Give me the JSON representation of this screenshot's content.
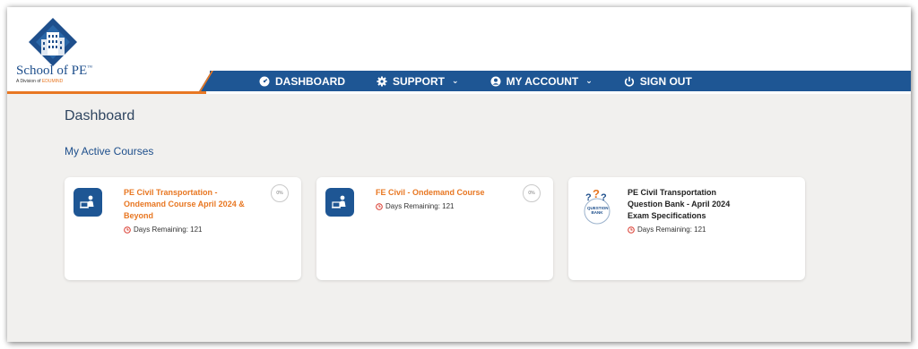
{
  "brand": {
    "name": "School of PE",
    "trademark": "™",
    "division_prefix": "A Division of",
    "division_brand": "EDUMIND"
  },
  "nav": [
    {
      "label": "DASHBOARD",
      "icon": "tachometer-icon",
      "dropdown": false
    },
    {
      "label": "SUPPORT",
      "icon": "gear-icon",
      "dropdown": true
    },
    {
      "label": "MY ACCOUNT",
      "icon": "user-circle-icon",
      "dropdown": true
    },
    {
      "label": "SIGN OUT",
      "icon": "power-icon",
      "dropdown": false
    }
  ],
  "page": {
    "title": "Dashboard",
    "section_title": "My Active Courses"
  },
  "courses": [
    {
      "title": "PE Civil Transportation - Ondemand Course April 2024 & Beyond",
      "days_remaining": "Days Remaining: 121",
      "progress": "0%",
      "icon": "ondemand-course-icon"
    },
    {
      "title": "FE Civil - Ondemand Course",
      "days_remaining": "Days Remaining: 121",
      "progress": "0%",
      "icon": "ondemand-course-icon"
    },
    {
      "title": "PE Civil Transportation Question Bank - April 2024 Exam Specifications",
      "days_remaining": "Days Remaining: 121",
      "icon": "question-bank-icon",
      "icon_text": "QUESTION BANK"
    }
  ],
  "colors": {
    "primary_blue": "#1e5694",
    "accent_orange": "#e87722",
    "background": "#f1f0ee",
    "title_text": "#2f4560"
  }
}
